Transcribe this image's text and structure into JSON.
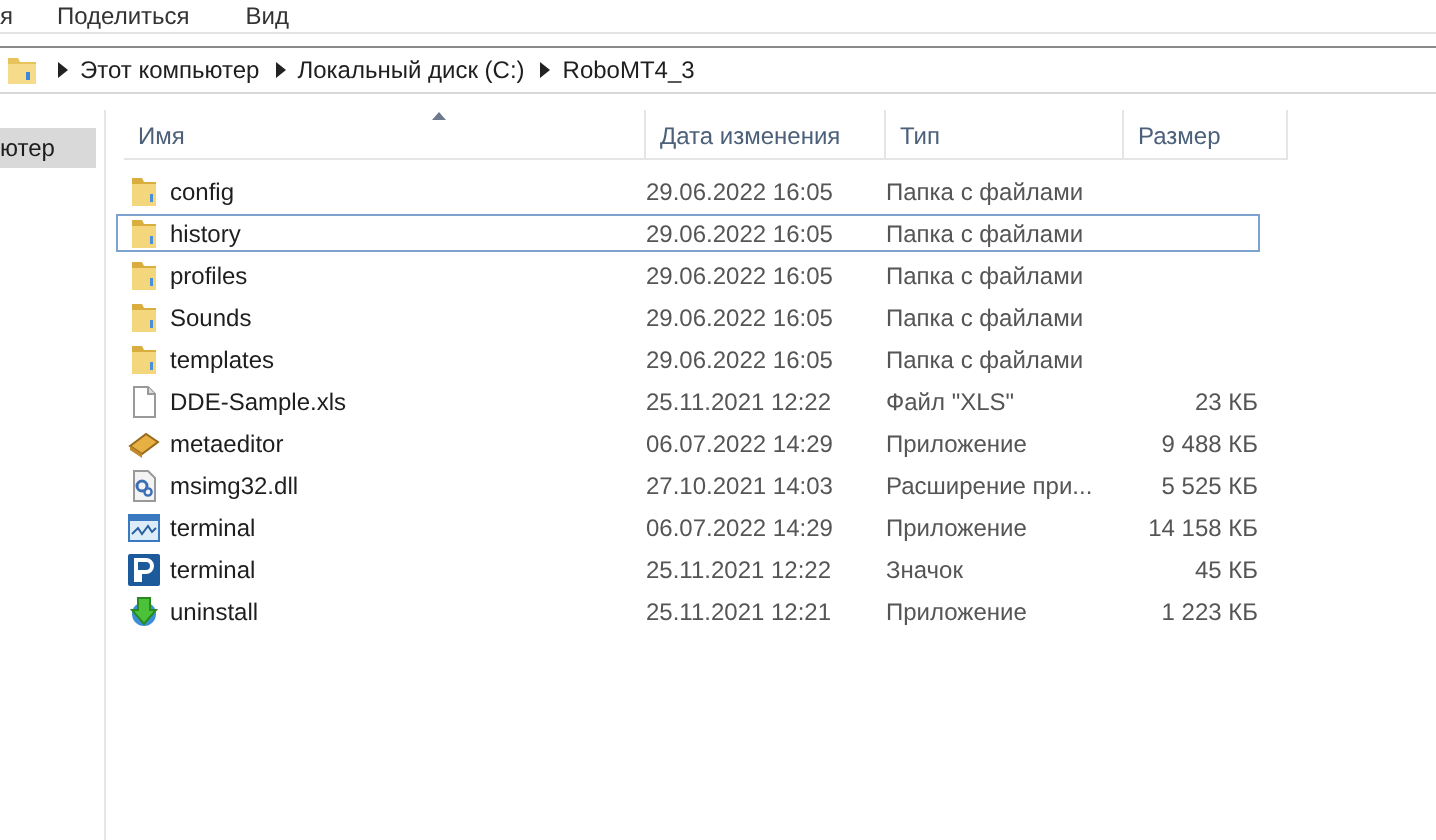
{
  "menu": [
    "я",
    "Поделиться",
    "Вид"
  ],
  "breadcrumbs": [
    "Этот компьютер",
    "Локальный диск (C:)",
    "RoboMT4_3"
  ],
  "navigation": {
    "items": [
      {
        "label": "ютер",
        "selected": true
      }
    ]
  },
  "table": {
    "columns": [
      {
        "label": "Имя",
        "sorted": true
      },
      {
        "label": "Дата изменения",
        "sorted": false
      },
      {
        "label": "Тип",
        "sorted": false
      },
      {
        "label": "Размер",
        "sorted": false
      }
    ],
    "rows": [
      {
        "kind": "folder",
        "name": "config",
        "date": "29.06.2022 16:05",
        "type": "Папка с файлами",
        "focused": false
      },
      {
        "kind": "folder",
        "name": "history",
        "date": "29.06.2022 16:05",
        "type": "Папка с файлами",
        "focused": true
      },
      {
        "kind": "folder",
        "name": "profiles",
        "date": "29.06.2022 16:05",
        "type": "Папка с файлами",
        "focused": false
      },
      {
        "kind": "folder",
        "name": "Sounds",
        "date": "29.06.2022 16:05",
        "type": "Папка с файлами",
        "focused": false
      },
      {
        "kind": "folder",
        "name": "templates",
        "date": "29.06.2022 16:05",
        "type": "Папка с файлами",
        "focused": false
      },
      {
        "kind": "document",
        "name": "DDE-Sample.xls",
        "date": "25.11.2021 12:22",
        "type": "Файл \"XLS\"",
        "size": "23 КБ",
        "focused": false
      },
      {
        "kind": "editor",
        "name": "metaeditor",
        "date": "06.07.2022 14:29",
        "type": "Приложение",
        "size": "9 488 КБ",
        "focused": false
      },
      {
        "kind": "library",
        "name": "msimg32.dll",
        "date": "27.10.2021 14:03",
        "type": "Расширение при...",
        "size": "5 525 КБ",
        "focused": false
      },
      {
        "kind": "chart_app",
        "name": "terminal",
        "date": "06.07.2022 14:29",
        "type": "Приложение",
        "size": "14 158 КБ",
        "focused": false
      },
      {
        "kind": "logo",
        "name": "terminal",
        "date": "25.11.2021 12:22",
        "type": "Значок",
        "size": "45 КБ",
        "focused": false
      },
      {
        "kind": "installer",
        "name": "uninstall",
        "date": "25.11.2021 12:21",
        "type": "Приложение",
        "size": "1 223 КБ",
        "focused": false
      }
    ]
  }
}
